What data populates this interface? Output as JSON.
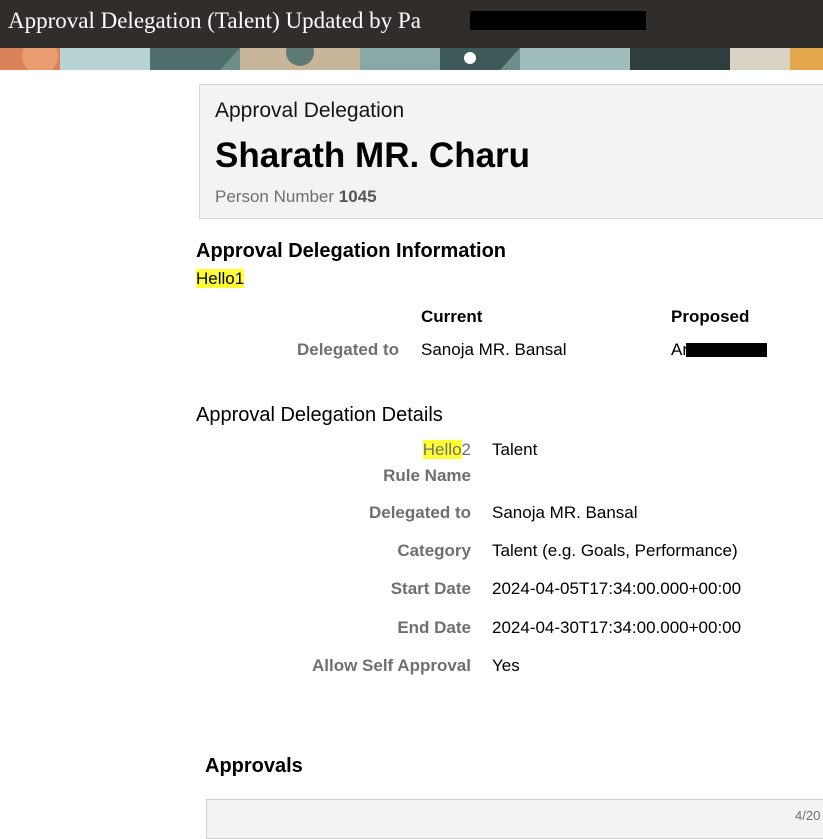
{
  "window": {
    "title": "Approval Delegation (Talent) Updated by Pa"
  },
  "header": {
    "label": "Approval Delegation",
    "person_name": "Sharath MR. Charu",
    "person_number_label": "Person Number",
    "person_number": "1045"
  },
  "info_section": {
    "title": "Approval Delegation Information",
    "note": "Hello1",
    "col_current": "Current",
    "col_proposed": "Proposed",
    "row_label": "Delegated to",
    "current_value": "Sanoja MR. Bansal",
    "proposed_value": "Ar"
  },
  "details_section": {
    "title": "Approval Delegation Details",
    "rule_name_hl": "Hello",
    "rule_name_suffix": "2",
    "rule_name_label": "Rule Name",
    "rule_name_value": "Talent",
    "delegated_label": "Delegated to",
    "delegated_value": "Sanoja MR. Bansal",
    "category_label": "Category",
    "category_value": "Talent (e.g. Goals, Performance)",
    "start_label": "Start Date",
    "start_value": "2024-04-05T17:34:00.000+00:00",
    "end_label": "End Date",
    "end_value": "2024-04-30T17:34:00.000+00:00",
    "self_label": "Allow Self Approval",
    "self_value": "Yes"
  },
  "approvals": {
    "title": "Approvals",
    "date_partial": "4/20"
  },
  "colors": {
    "titlebar_bg": "#312d2a",
    "highlight": "#ffff33",
    "label_gray": "#6f6f6f",
    "card_bg": "#f3f3f3"
  }
}
